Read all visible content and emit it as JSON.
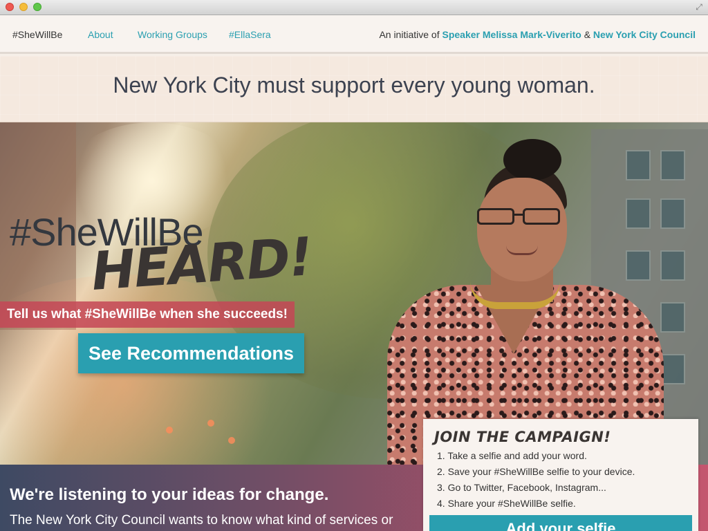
{
  "nav": {
    "brand": "#SheWillBe",
    "links": [
      "About",
      "Working Groups",
      "#EllaSera"
    ],
    "initiative_prefix": "An initiative of",
    "speaker": "Speaker Melissa Mark-Viverito",
    "amp": "&",
    "council": "New York City Council"
  },
  "band": {
    "tagline": "New York City must support every young woman."
  },
  "hero": {
    "hashtag": "#SheWillBe",
    "word": "HEARD!",
    "prompt": "Tell us what #SheWillBe when she succeeds!",
    "cta": "See Recommendations"
  },
  "bottom": {
    "heading": "We're listening to your ideas for change.",
    "subtext": "The New York City Council wants to know what kind of services or"
  },
  "campaign": {
    "title": "JOIN THE CAMPAIGN!",
    "steps": [
      "1. Take a selfie and add your word.",
      "2. Save your #SheWillBe selfie to your device.",
      "3. Go to Twitter, Facebook, Instagram...",
      "4. Share your #SheWillBe selfie."
    ],
    "button": "Add your selfie"
  },
  "colors": {
    "accent": "#2a9fb0",
    "text": "#3c4250",
    "band": "#f5e9df"
  }
}
